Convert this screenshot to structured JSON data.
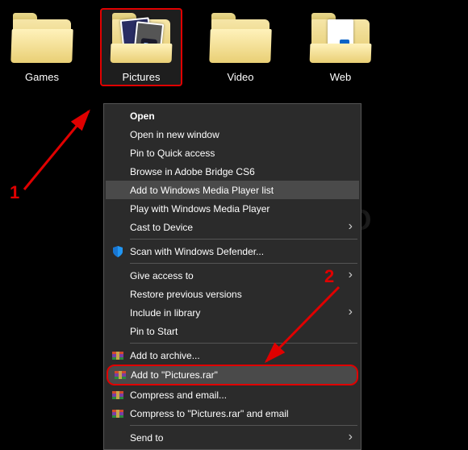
{
  "folders": [
    {
      "label": "Games"
    },
    {
      "label": "Pictures"
    },
    {
      "label": "Video"
    },
    {
      "label": "Web"
    }
  ],
  "menu": {
    "open": "Open",
    "open_new_window": "Open in new window",
    "pin_quick_access": "Pin to Quick access",
    "browse_bridge": "Browse in Adobe Bridge CS6",
    "add_wmp_list": "Add to Windows Media Player list",
    "play_wmp": "Play with Windows Media Player",
    "cast": "Cast to Device",
    "scan_defender": "Scan with Windows Defender...",
    "give_access": "Give access to",
    "restore_prev": "Restore previous versions",
    "include_library": "Include in library",
    "pin_start": "Pin to Start",
    "add_archive": "Add to archive...",
    "add_rar": "Add to \"Pictures.rar\"",
    "compress_email": "Compress and email...",
    "compress_rar_email": "Compress to \"Pictures.rar\" and email",
    "send_to": "Send to"
  },
  "annotations": {
    "one": "1",
    "two": "2"
  },
  "watermark": "PACITEKNO"
}
